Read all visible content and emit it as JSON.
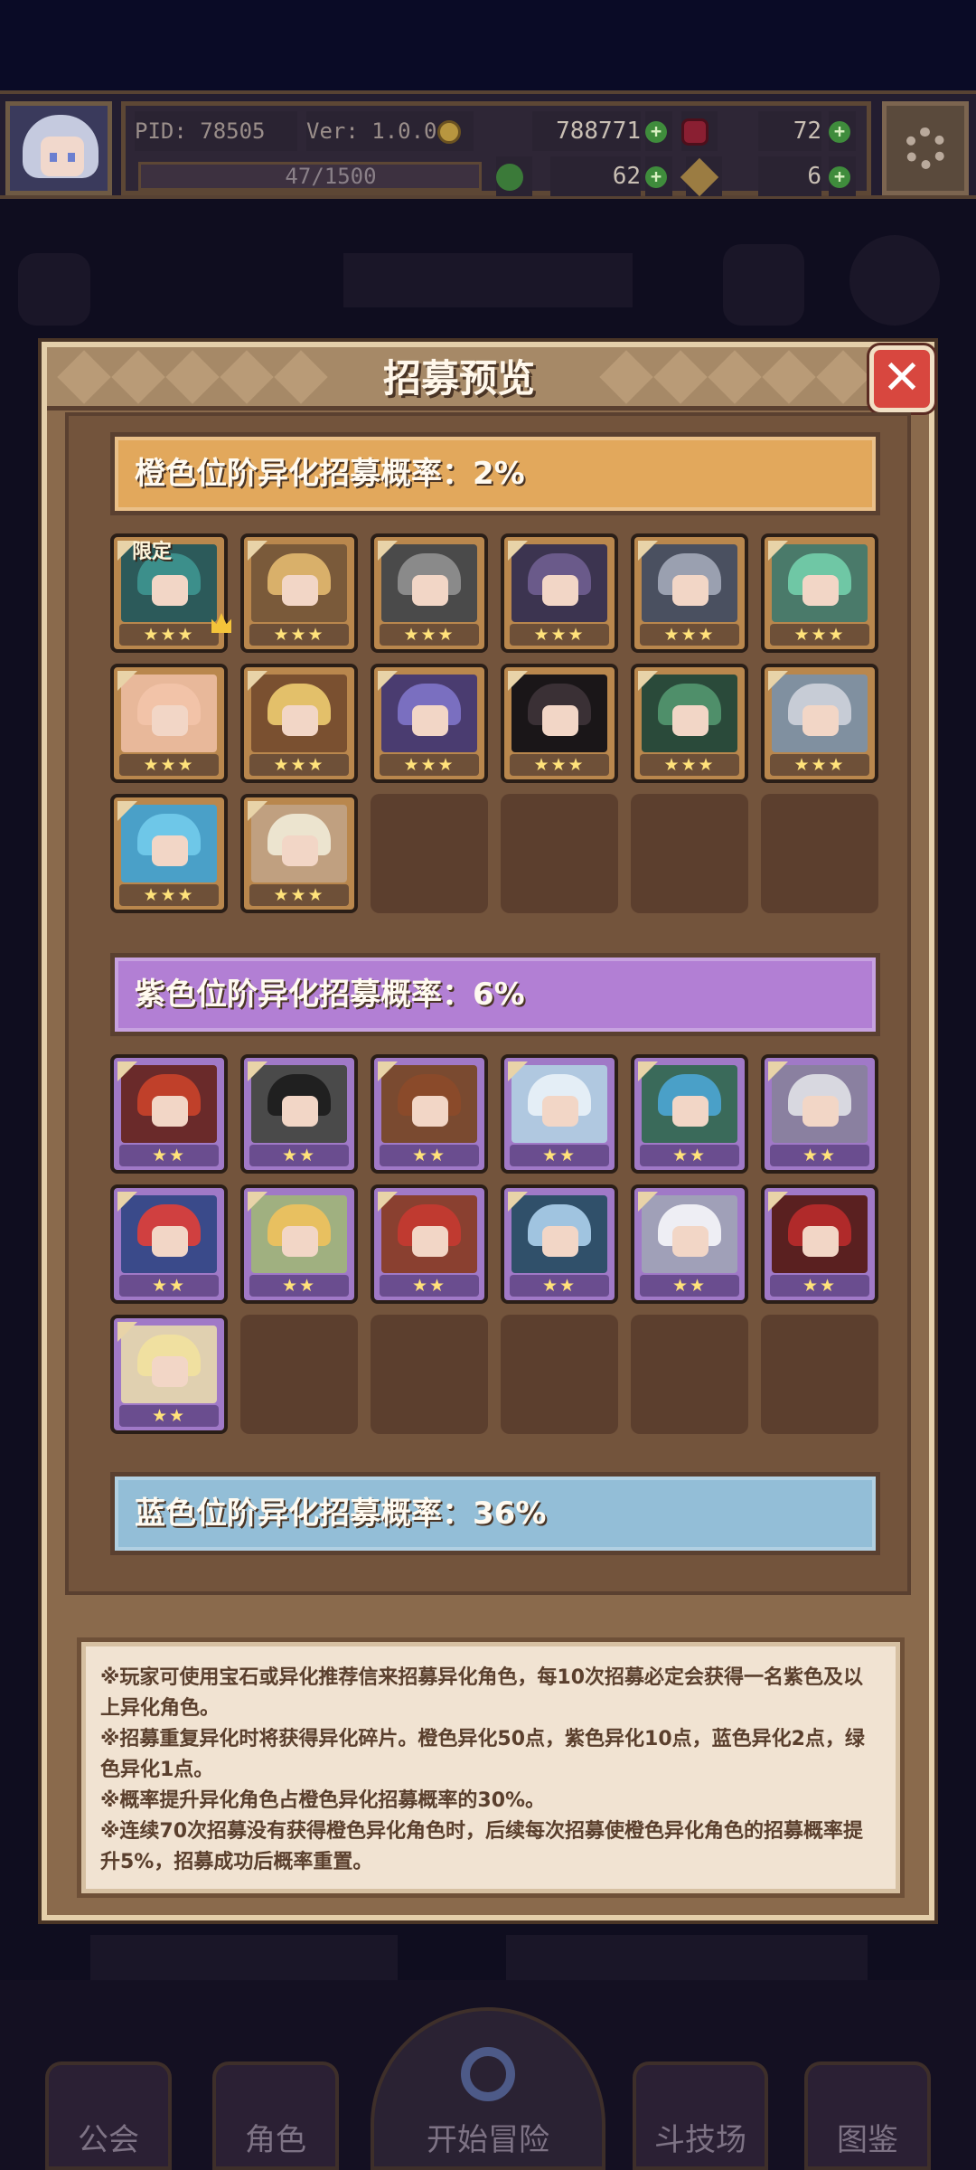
{
  "hud": {
    "pid": "PID: 78505",
    "version": "Ver: 1.0.0.8",
    "gold": "788771",
    "gems": "72",
    "stamina": "47/1500",
    "clover_count": "62",
    "key_count": "6"
  },
  "modal": {
    "title": "招募预览",
    "close_icon": "close-icon",
    "orange_banner": "橙色位阶异化招募概率：2%",
    "purple_banner": "紫色位阶异化招募概率：6%",
    "blue_banner": "蓝色位阶异化招募概率：36%",
    "limited_tag": "限定",
    "stars3": "★★★",
    "stars2": "★★",
    "notes": [
      "※玩家可使用宝石或异化推荐信来招募异化角色，每10次招募必定会获得一名紫色及以",
      "上异化角色。",
      "※招募重复异化时将获得异化碎片。橙色异化50点，紫色异化10点，蓝色异化2点，绿",
      "色异化1点。",
      "※概率提升异化角色占橙色异化招募概率的30%。",
      "※连续70次招募没有获得橙色异化角色时，后续每次招募使橙色异化角色的招募概率提",
      "升5%，招募成功后概率重置。"
    ]
  },
  "colors": {
    "orange_card": "#b9874d",
    "purple_card": "#a079c7",
    "orange_banner": "#e2a85c",
    "purple_banner": "#b27fd4",
    "blue_banner": "#93bed7"
  },
  "nav": {
    "guild": "公会",
    "characters": "角色",
    "adventure": "开始冒险",
    "arena": "斗技场",
    "codex": "图鉴"
  }
}
